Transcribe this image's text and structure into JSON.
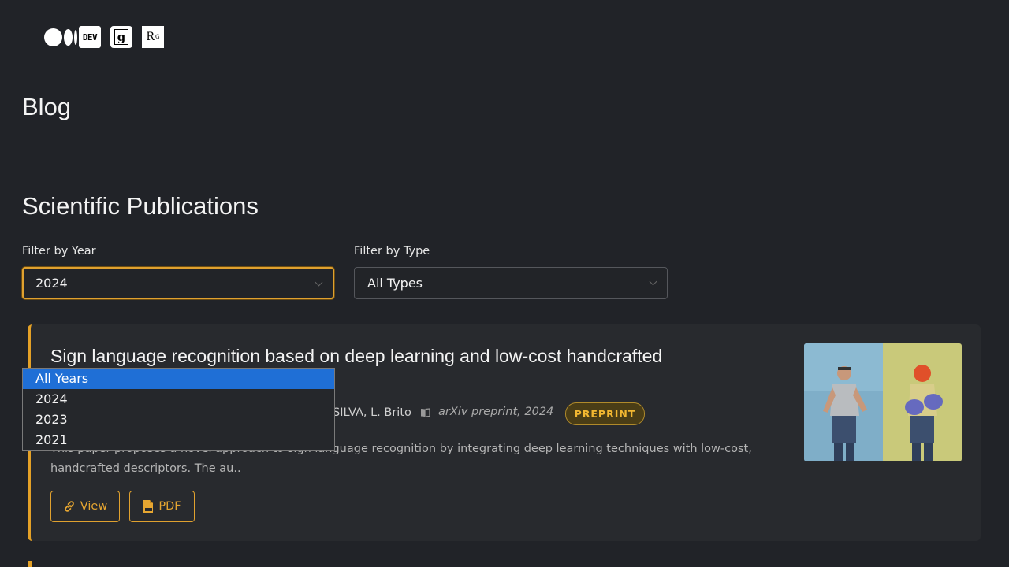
{
  "header": {
    "logos": [
      {
        "name": "medium-logo"
      },
      {
        "name": "dev-logo",
        "text": "DEV"
      },
      {
        "name": "google-scholar-logo"
      },
      {
        "name": "researchgate-logo",
        "text": "R",
        "sup": "G"
      }
    ]
  },
  "blog_heading": "Blog",
  "section_heading": "Scientific Publications",
  "filters": {
    "year": {
      "label": "Filter by Year",
      "value": "2024"
    },
    "type": {
      "label": "Filter by Type",
      "value": "All Types"
    }
  },
  "year_dropdown": {
    "options": [
      "All Years",
      "2024",
      "2023",
      "2021"
    ],
    "highlighted": "All Years"
  },
  "publication": {
    "title": "Sign language recognition based on deep learning and low-cost handcrafted",
    "authors_visible": "SILVA, L. Brito",
    "venue": "arXiv preprint, 2024",
    "badge": "PREPRINT",
    "abstract": "This paper proposes a novel approach to sign language recognition by integrating deep learning techniques with low-cost, handcrafted descriptors. The au..",
    "buttons": {
      "view": "View",
      "pdf": "PDF"
    }
  },
  "colors": {
    "background": "#212328",
    "card": "#282a2e",
    "accent": "#e4a127",
    "dropdown_highlight": "#1f6fd6"
  }
}
